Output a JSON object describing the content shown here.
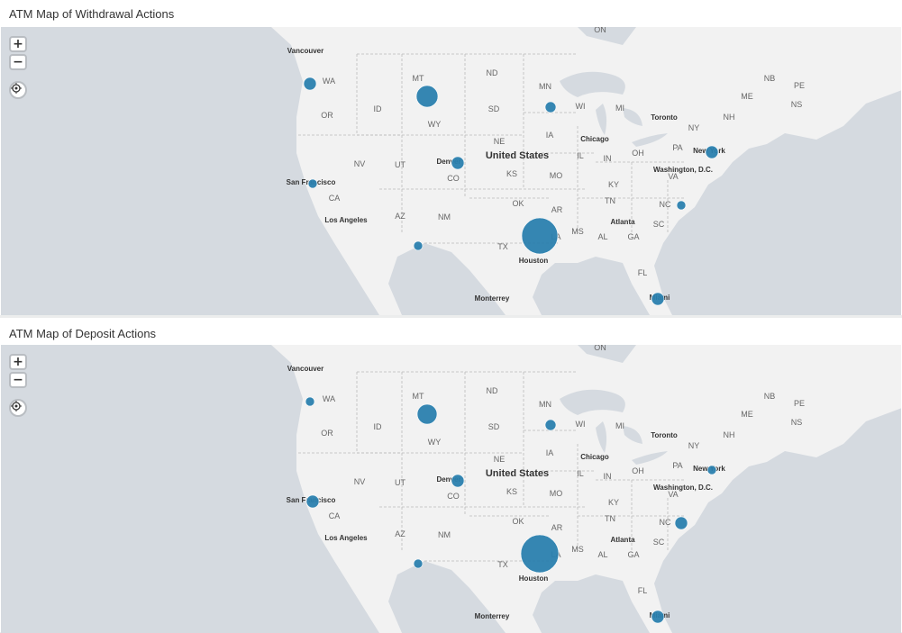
{
  "panels": [
    {
      "title": "ATM Map of Withdrawal Actions",
      "bubbles": [
        {
          "place": "WA",
          "size": 7
        },
        {
          "place": "MT",
          "size": 12
        },
        {
          "place": "MN",
          "size": 6
        },
        {
          "place": "Denver",
          "size": 7
        },
        {
          "place": "San Francisco",
          "size": 5
        },
        {
          "place": "Southern Arizona",
          "size": 5
        },
        {
          "place": "Houston",
          "size": 20
        },
        {
          "place": "New York",
          "size": 7
        },
        {
          "place": "NC",
          "size": 5
        },
        {
          "place": "Miami",
          "size": 7
        }
      ]
    },
    {
      "title": "ATM Map of Deposit Actions",
      "bubbles": [
        {
          "place": "WA",
          "size": 5
        },
        {
          "place": "MT",
          "size": 11
        },
        {
          "place": "MN",
          "size": 6
        },
        {
          "place": "Denver",
          "size": 7
        },
        {
          "place": "San Francisco",
          "size": 7
        },
        {
          "place": "Southern Arizona",
          "size": 5
        },
        {
          "place": "Houston",
          "size": 21
        },
        {
          "place": "New York",
          "size": 5
        },
        {
          "place": "NC",
          "size": 7
        },
        {
          "place": "Miami",
          "size": 7
        }
      ]
    }
  ],
  "controls": {
    "zoom_in": "+",
    "zoom_out": "−",
    "locate_icon": "crosshair-icon"
  },
  "labels": {
    "country": "United States",
    "states": [
      "WA",
      "OR",
      "MT",
      "ID",
      "WY",
      "NV",
      "UT",
      "CO",
      "CA",
      "AZ",
      "NM",
      "ND",
      "SD",
      "NE",
      "KS",
      "OK",
      "TX",
      "MN",
      "IA",
      "MO",
      "AR",
      "LA",
      "WI",
      "IL",
      "MI",
      "IN",
      "OH",
      "KY",
      "TN",
      "MS",
      "AL",
      "GA",
      "FL",
      "SC",
      "NC",
      "VA",
      "PA",
      "NY",
      "NB",
      "PE",
      "ME",
      "NS",
      "NH",
      "ON"
    ],
    "cities": [
      "Vancouver",
      "San Francisco",
      "Los Angeles",
      "Denver",
      "Chicago",
      "Toronto",
      "New York",
      "Washington, D.C.",
      "Atlanta",
      "Houston",
      "Monterrey",
      "Miami"
    ]
  },
  "colors": {
    "bubble": "#2a7fae",
    "land": "#f2f2f2",
    "water": "#d5dae0",
    "border": "#bbbbbb"
  }
}
